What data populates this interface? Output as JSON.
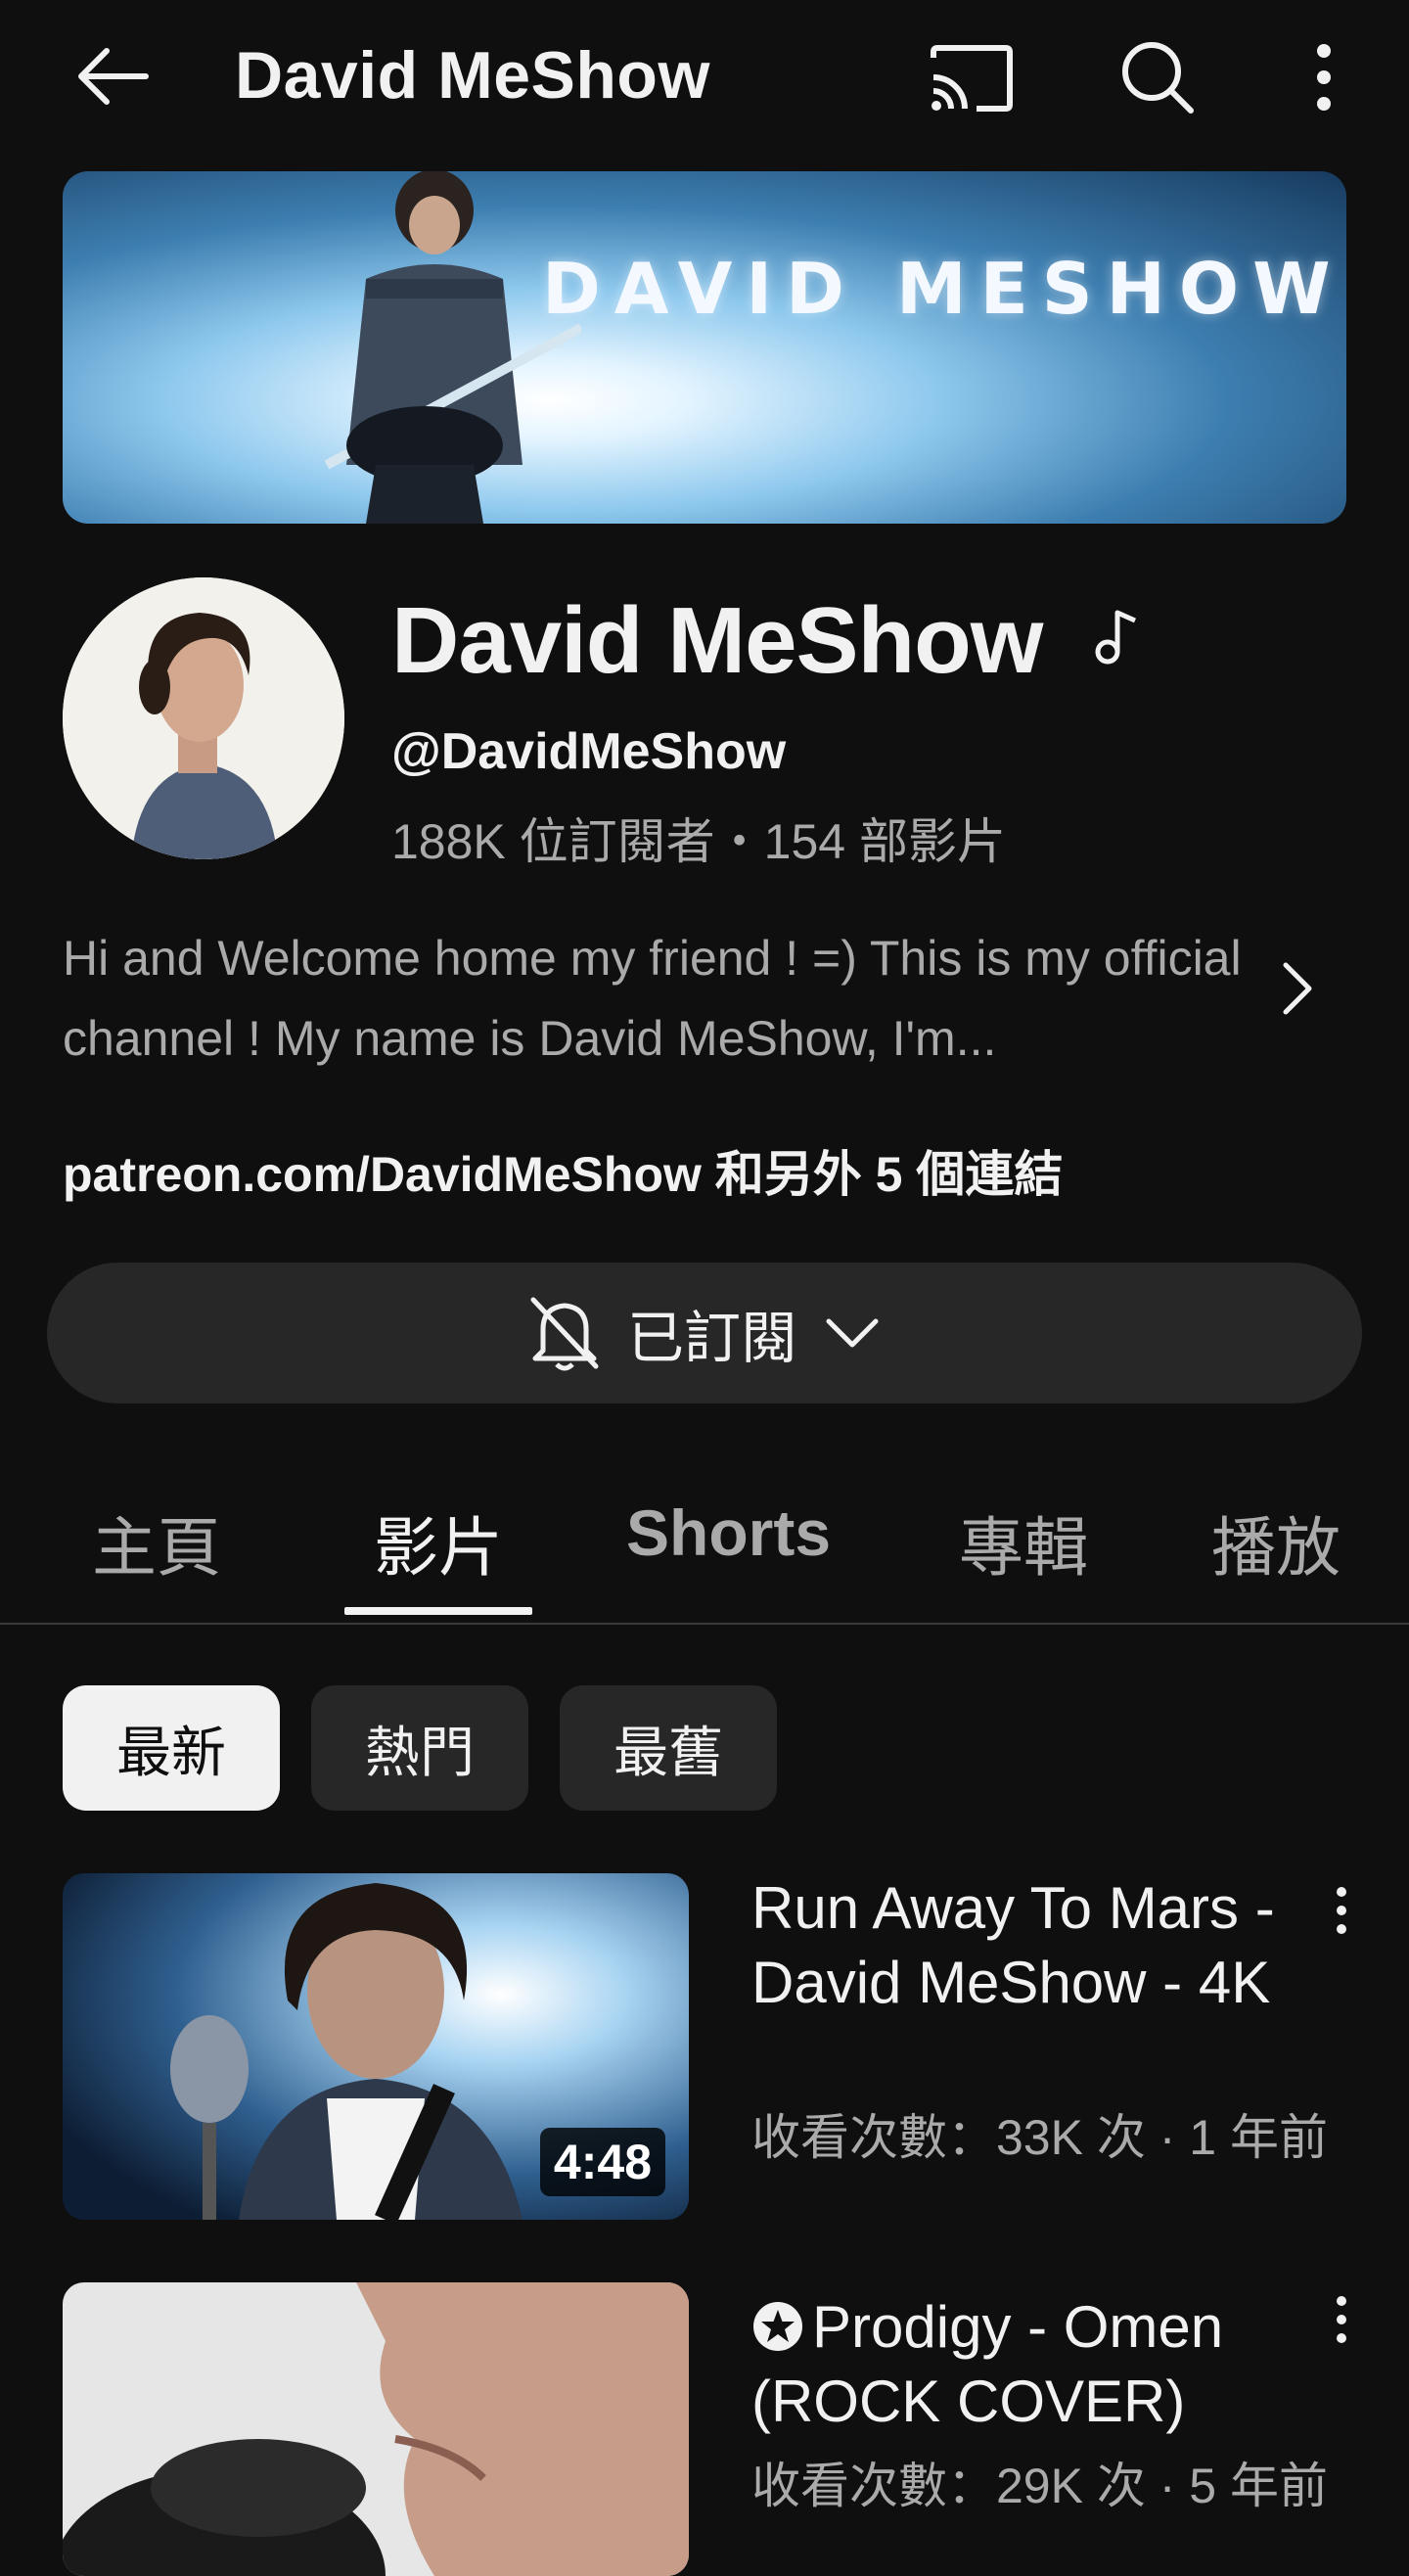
{
  "header": {
    "title": "David MeShow",
    "back_icon": "arrow-left-icon",
    "cast_icon": "cast-icon",
    "search_icon": "search-icon",
    "more_icon": "more-vert-icon"
  },
  "banner": {
    "text": "DAVID MESHOW"
  },
  "channel": {
    "name": "David MeShow",
    "handle": "@DavidMeShow",
    "stats": "188K 位訂閱者・154 部影片",
    "description": "Hi and Welcome home my friend ! =) This is my official channel ! My name is David MeShow, I'm...",
    "link_main": "patreon.com/DavidMeShow",
    "link_suffix": " 和另外 5 個連結"
  },
  "subscribe": {
    "label": "已訂閱",
    "icon": "bell-off-icon"
  },
  "tabs": [
    "主頁",
    "影片",
    "Shorts",
    "專輯",
    "播放"
  ],
  "active_tab": "影片",
  "chips": [
    "最新",
    "熱門",
    "最舊"
  ],
  "active_chip": "最新",
  "videos": [
    {
      "title": "Run Away To Mars - David MeShow - 4K",
      "meta": "收看次數：33K 次 · 1 年前",
      "duration": "4:48"
    },
    {
      "title": "Prodigy - Omen (ROCK COVER)",
      "meta": "收看次數：29K 次 · 5 年前"
    }
  ],
  "colors": {
    "background": "#0f0f0f",
    "secondary_text": "#aaaaaa",
    "surface": "#272727"
  }
}
